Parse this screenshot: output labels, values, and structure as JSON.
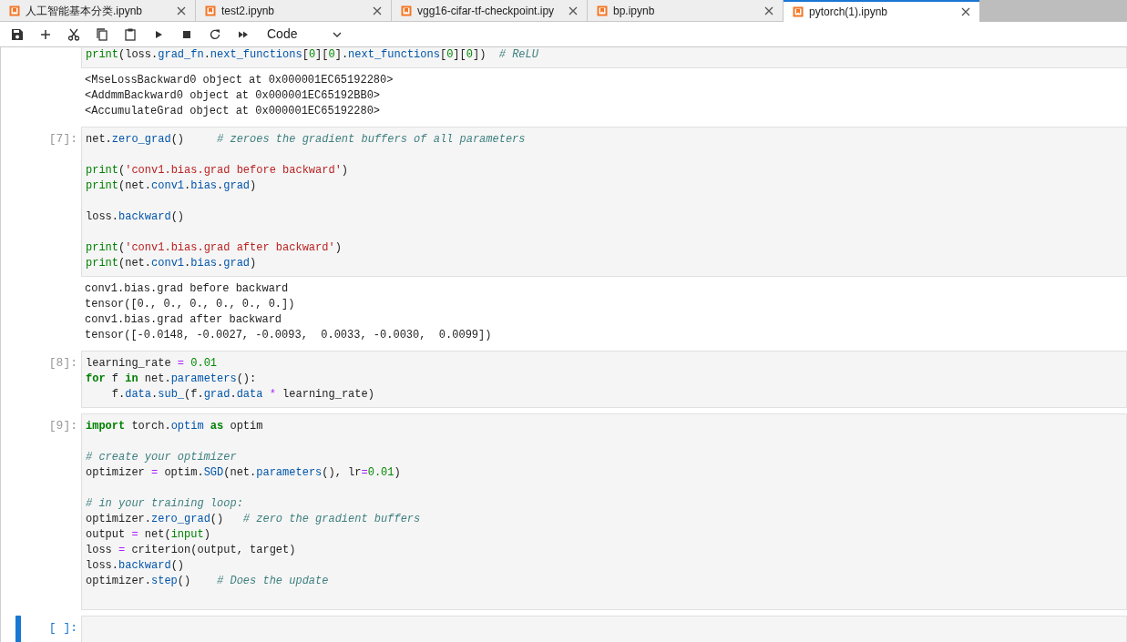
{
  "tabs": [
    {
      "label": "人工智能基本分类.ipynb",
      "selected": false
    },
    {
      "label": "test2.ipynb",
      "selected": false
    },
    {
      "label": "vgg16-cifar-tf-checkpoint.ipy",
      "selected": false
    },
    {
      "label": "bp.ipynb",
      "selected": false
    },
    {
      "label": "pytorch(1).ipynb",
      "selected": true
    }
  ],
  "toolbar": {
    "cell_type": "Code"
  },
  "cells": [
    {
      "active": false,
      "lines": [
        {
          "kind": "code",
          "tokens": [
            {
              "text": "print",
              "kind": "builtin"
            },
            {
              "text": "(loss.",
              "kind": "plain"
            },
            {
              "text": "grad_fn",
              "kind": "attr"
            },
            {
              "text": ".",
              "kind": "plain"
            },
            {
              "text": "next_functions",
              "kind": "attr"
            },
            {
              "text": "[",
              "kind": "plain"
            },
            {
              "text": "0",
              "kind": "number"
            },
            {
              "text": "][",
              "kind": "plain"
            },
            {
              "text": "0",
              "kind": "number"
            },
            {
              "text": "].",
              "kind": "plain"
            },
            {
              "text": "next_functions",
              "kind": "attr"
            },
            {
              "text": "[",
              "kind": "plain"
            },
            {
              "text": "0",
              "kind": "number"
            },
            {
              "text": "][",
              "kind": "plain"
            },
            {
              "text": "0",
              "kind": "number"
            },
            {
              "text": "])  ",
              "kind": "plain"
            },
            {
              "text": "# ReLU",
              "kind": "comment"
            }
          ]
        }
      ],
      "output": "<MseLossBackward0 object at 0x000001EC65192280>\n<AddmmBackward0 object at 0x000001EC65192BB0>\n<AccumulateGrad object at 0x000001EC65192280>"
    },
    {
      "prompt": "[7]:",
      "active": false,
      "lines": [
        {
          "kind": "code",
          "tokens": [
            {
              "text": "net.",
              "kind": "plain"
            },
            {
              "text": "zero_grad",
              "kind": "attr"
            },
            {
              "text": "()     ",
              "kind": "plain"
            },
            {
              "text": "# zeroes the gradient buffers of all parameters",
              "kind": "comment"
            }
          ]
        },
        {
          "kind": "blank"
        },
        {
          "kind": "code",
          "tokens": [
            {
              "text": "print",
              "kind": "builtin"
            },
            {
              "text": "(",
              "kind": "plain"
            },
            {
              "text": "'conv1.bias.grad before backward'",
              "kind": "string"
            },
            {
              "text": ")",
              "kind": "plain"
            }
          ]
        },
        {
          "kind": "code",
          "tokens": [
            {
              "text": "print",
              "kind": "builtin"
            },
            {
              "text": "(net.",
              "kind": "plain"
            },
            {
              "text": "conv1",
              "kind": "attr"
            },
            {
              "text": ".",
              "kind": "plain"
            },
            {
              "text": "bias",
              "kind": "attr"
            },
            {
              "text": ".",
              "kind": "plain"
            },
            {
              "text": "grad",
              "kind": "attr"
            },
            {
              "text": ")",
              "kind": "plain"
            }
          ]
        },
        {
          "kind": "blank"
        },
        {
          "kind": "code",
          "tokens": [
            {
              "text": "loss.",
              "kind": "plain"
            },
            {
              "text": "backward",
              "kind": "attr"
            },
            {
              "text": "()",
              "kind": "plain"
            }
          ]
        },
        {
          "kind": "blank"
        },
        {
          "kind": "code",
          "tokens": [
            {
              "text": "print",
              "kind": "builtin"
            },
            {
              "text": "(",
              "kind": "plain"
            },
            {
              "text": "'conv1.bias.grad after backward'",
              "kind": "string"
            },
            {
              "text": ")",
              "kind": "plain"
            }
          ]
        },
        {
          "kind": "code",
          "tokens": [
            {
              "text": "print",
              "kind": "builtin"
            },
            {
              "text": "(net.",
              "kind": "plain"
            },
            {
              "text": "conv1",
              "kind": "attr"
            },
            {
              "text": ".",
              "kind": "plain"
            },
            {
              "text": "bias",
              "kind": "attr"
            },
            {
              "text": ".",
              "kind": "plain"
            },
            {
              "text": "grad",
              "kind": "attr"
            },
            {
              "text": ")",
              "kind": "plain"
            }
          ]
        }
      ],
      "output": "conv1.bias.grad before backward\ntensor([0., 0., 0., 0., 0., 0.])\nconv1.bias.grad after backward\ntensor([-0.0148, -0.0027, -0.0093,  0.0033, -0.0030,  0.0099])"
    },
    {
      "prompt": "[8]:",
      "active": false,
      "lines": [
        {
          "kind": "code",
          "tokens": [
            {
              "text": "learning_rate ",
              "kind": "plain"
            },
            {
              "text": "=",
              "kind": "operator"
            },
            {
              "text": " 0.01",
              "kind": "number"
            }
          ]
        },
        {
          "kind": "code",
          "tokens": [
            {
              "text": "for",
              "kind": "keyword"
            },
            {
              "text": " f ",
              "kind": "plain"
            },
            {
              "text": "in",
              "kind": "keyword"
            },
            {
              "text": " net.",
              "kind": "plain"
            },
            {
              "text": "parameters",
              "kind": "attr"
            },
            {
              "text": "():",
              "kind": "plain"
            }
          ]
        },
        {
          "kind": "code",
          "tokens": [
            {
              "text": "    f.",
              "kind": "plain"
            },
            {
              "text": "data",
              "kind": "attr"
            },
            {
              "text": ".",
              "kind": "plain"
            },
            {
              "text": "sub_",
              "kind": "attr"
            },
            {
              "text": "(f.",
              "kind": "plain"
            },
            {
              "text": "grad",
              "kind": "attr"
            },
            {
              "text": ".",
              "kind": "plain"
            },
            {
              "text": "data",
              "kind": "attr"
            },
            {
              "text": " *",
              "kind": "operator"
            },
            {
              "text": " learning_rate)",
              "kind": "plain"
            }
          ]
        }
      ]
    },
    {
      "prompt": "[9]:",
      "active": false,
      "lines": [
        {
          "kind": "code",
          "tokens": [
            {
              "text": "import",
              "kind": "keyword"
            },
            {
              "text": " torch.",
              "kind": "plain"
            },
            {
              "text": "optim",
              "kind": "attr"
            },
            {
              "text": " as",
              "kind": "keyword"
            },
            {
              "text": " optim",
              "kind": "plain"
            }
          ]
        },
        {
          "kind": "blank"
        },
        {
          "kind": "code",
          "tokens": [
            {
              "text": "# create your optimizer",
              "kind": "comment"
            }
          ]
        },
        {
          "kind": "code",
          "tokens": [
            {
              "text": "optimizer ",
              "kind": "plain"
            },
            {
              "text": "=",
              "kind": "operator"
            },
            {
              "text": " optim.",
              "kind": "plain"
            },
            {
              "text": "SGD",
              "kind": "attr"
            },
            {
              "text": "(net.",
              "kind": "plain"
            },
            {
              "text": "parameters",
              "kind": "attr"
            },
            {
              "text": "(), lr",
              "kind": "plain"
            },
            {
              "text": "=",
              "kind": "operator"
            },
            {
              "text": "0.01",
              "kind": "number"
            },
            {
              "text": ")",
              "kind": "plain"
            }
          ]
        },
        {
          "kind": "blank"
        },
        {
          "kind": "code",
          "tokens": [
            {
              "text": "# in your training loop:",
              "kind": "comment"
            }
          ]
        },
        {
          "kind": "code",
          "tokens": [
            {
              "text": "optimizer.",
              "kind": "plain"
            },
            {
              "text": "zero_grad",
              "kind": "attr"
            },
            {
              "text": "()   ",
              "kind": "plain"
            },
            {
              "text": "# zero the gradient buffers",
              "kind": "comment"
            }
          ]
        },
        {
          "kind": "code",
          "tokens": [
            {
              "text": "output ",
              "kind": "plain"
            },
            {
              "text": "=",
              "kind": "operator"
            },
            {
              "text": " net(",
              "kind": "plain"
            },
            {
              "text": "input",
              "kind": "builtin"
            },
            {
              "text": ")",
              "kind": "plain"
            }
          ]
        },
        {
          "kind": "code",
          "tokens": [
            {
              "text": "loss ",
              "kind": "plain"
            },
            {
              "text": "=",
              "kind": "operator"
            },
            {
              "text": " criterion(output, target)",
              "kind": "plain"
            }
          ]
        },
        {
          "kind": "code",
          "tokens": [
            {
              "text": "loss.",
              "kind": "plain"
            },
            {
              "text": "backward",
              "kind": "attr"
            },
            {
              "text": "()",
              "kind": "plain"
            }
          ]
        },
        {
          "kind": "code",
          "tokens": [
            {
              "text": "optimizer.",
              "kind": "plain"
            },
            {
              "text": "step",
              "kind": "attr"
            },
            {
              "text": "()    ",
              "kind": "plain"
            },
            {
              "text": "# Does the update",
              "kind": "comment"
            }
          ]
        },
        {
          "kind": "blank"
        }
      ]
    },
    {
      "prompt": "[ ]:",
      "active": true
    }
  ]
}
